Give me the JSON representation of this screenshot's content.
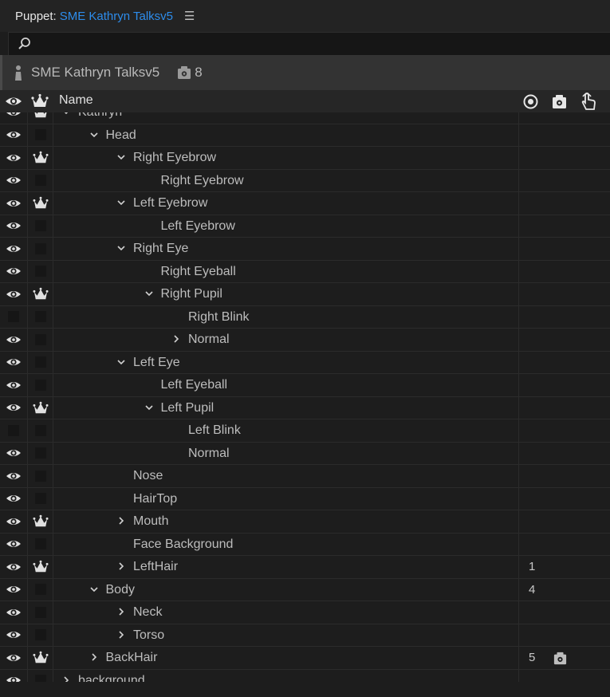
{
  "title_bar": {
    "panel_label": "Puppet:",
    "puppet_link": "SME Kathryn Talksv5",
    "menu_icon": "hamburger-menu-icon"
  },
  "search": {
    "value": "",
    "icon": "search-icon"
  },
  "puppet_bar": {
    "name": "SME Kathryn Talksv5",
    "count": "8",
    "count_icon": "puppet-count-icon"
  },
  "header": {
    "name": "Name",
    "columns_icons": [
      "eye-icon",
      "crown-icon",
      "target-icon",
      "camera-icon",
      "hand-icon"
    ]
  },
  "rows": [
    {
      "label": "Kathryn",
      "depth": 0,
      "expander": "expanded",
      "eye": true,
      "crown": true,
      "num": "",
      "num_icon": false
    },
    {
      "label": "Head",
      "depth": 1,
      "expander": "expanded",
      "eye": true,
      "crown": false,
      "num": "",
      "num_icon": false
    },
    {
      "label": "Right Eyebrow",
      "depth": 2,
      "expander": "expanded",
      "eye": true,
      "crown": true,
      "num": "",
      "num_icon": false
    },
    {
      "label": "Right Eyebrow",
      "depth": 3,
      "expander": "none",
      "eye": true,
      "crown": false,
      "num": "",
      "num_icon": false
    },
    {
      "label": "Left Eyebrow",
      "depth": 2,
      "expander": "expanded",
      "eye": true,
      "crown": true,
      "num": "",
      "num_icon": false
    },
    {
      "label": "Left Eyebrow",
      "depth": 3,
      "expander": "none",
      "eye": true,
      "crown": false,
      "num": "",
      "num_icon": false
    },
    {
      "label": "Right Eye",
      "depth": 2,
      "expander": "expanded",
      "eye": true,
      "crown": false,
      "num": "",
      "num_icon": false
    },
    {
      "label": "Right Eyeball",
      "depth": 3,
      "expander": "none",
      "eye": true,
      "crown": false,
      "num": "",
      "num_icon": false
    },
    {
      "label": "Right Pupil",
      "depth": 3,
      "expander": "expanded",
      "eye": true,
      "crown": true,
      "num": "",
      "num_icon": false
    },
    {
      "label": "Right Blink",
      "depth": 4,
      "expander": "none",
      "eye": false,
      "crown": false,
      "num": "",
      "num_icon": false
    },
    {
      "label": "Normal",
      "depth": 4,
      "expander": "collapsed",
      "eye": true,
      "crown": false,
      "num": "",
      "num_icon": false
    },
    {
      "label": "Left Eye",
      "depth": 2,
      "expander": "expanded",
      "eye": true,
      "crown": false,
      "num": "",
      "num_icon": false
    },
    {
      "label": "Left Eyeball",
      "depth": 3,
      "expander": "none",
      "eye": true,
      "crown": false,
      "num": "",
      "num_icon": false
    },
    {
      "label": "Left Pupil",
      "depth": 3,
      "expander": "expanded",
      "eye": true,
      "crown": true,
      "num": "",
      "num_icon": false
    },
    {
      "label": "Left Blink",
      "depth": 4,
      "expander": "none",
      "eye": false,
      "crown": false,
      "num": "",
      "num_icon": false
    },
    {
      "label": "Normal",
      "depth": 4,
      "expander": "none",
      "eye": true,
      "crown": false,
      "num": "",
      "num_icon": false
    },
    {
      "label": "Nose",
      "depth": 2,
      "expander": "none",
      "eye": true,
      "crown": false,
      "num": "",
      "num_icon": false
    },
    {
      "label": "HairTop",
      "depth": 2,
      "expander": "none",
      "eye": true,
      "crown": false,
      "num": "",
      "num_icon": false
    },
    {
      "label": "Mouth",
      "depth": 2,
      "expander": "collapsed",
      "eye": true,
      "crown": true,
      "num": "",
      "num_icon": false
    },
    {
      "label": "Face Background",
      "depth": 2,
      "expander": "none",
      "eye": true,
      "crown": false,
      "num": "",
      "num_icon": false
    },
    {
      "label": "LeftHair",
      "depth": 2,
      "expander": "collapsed",
      "eye": true,
      "crown": true,
      "num": "1",
      "num_icon": false
    },
    {
      "label": "Body",
      "depth": 1,
      "expander": "expanded",
      "eye": true,
      "crown": false,
      "num": "4",
      "num_icon": false
    },
    {
      "label": "Neck",
      "depth": 2,
      "expander": "collapsed",
      "eye": true,
      "crown": false,
      "num": "",
      "num_icon": false
    },
    {
      "label": "Torso",
      "depth": 2,
      "expander": "collapsed",
      "eye": true,
      "crown": false,
      "num": "",
      "num_icon": false
    },
    {
      "label": "BackHair",
      "depth": 1,
      "expander": "collapsed",
      "eye": true,
      "crown": true,
      "num": "5",
      "num_icon": true
    },
    {
      "label": "background",
      "depth": 0,
      "expander": "collapsed",
      "eye": true,
      "crown": false,
      "num": "",
      "num_icon": false
    }
  ],
  "colors": {
    "accent_link": "#2d8ceb",
    "background": "#1d1d1d",
    "row_border": "#2b2b2b"
  }
}
